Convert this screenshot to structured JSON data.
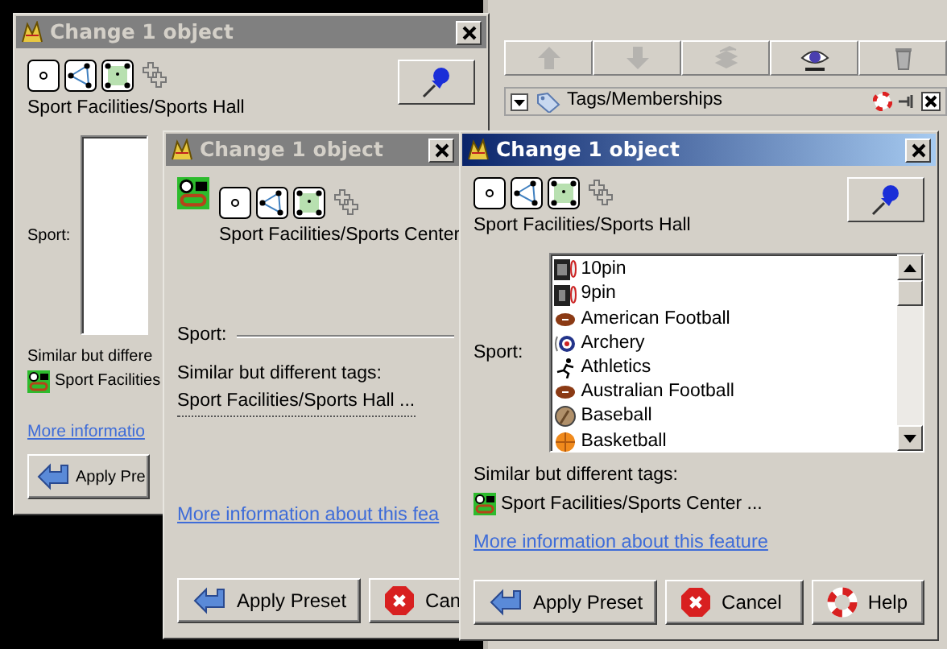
{
  "side_panel": {
    "toolbar": [
      {
        "kind": "up",
        "disabled": true
      },
      {
        "kind": "down",
        "disabled": true
      },
      {
        "kind": "layers",
        "disabled": true
      },
      {
        "kind": "eye",
        "disabled": false
      },
      {
        "kind": "trash",
        "disabled": false
      }
    ],
    "section": {
      "title": "Tags/Memberships",
      "expanded": true
    }
  },
  "windows": [
    {
      "title": "Change 1 object",
      "active": false,
      "preset_icon": false,
      "pin_button": true,
      "path": "Sport Facilities/Sports Hall",
      "sport": {
        "label": "Sport:",
        "kind": "listbox"
      },
      "similar": {
        "label": "Similar but differe",
        "items": [
          {
            "text": "Sport Facilities",
            "icon": true
          }
        ]
      },
      "link": "More informatio",
      "buttons": [
        {
          "label": "Apply Pre",
          "kind": "apply"
        }
      ]
    },
    {
      "title": "Change 1 object",
      "active": false,
      "preset_icon": true,
      "pin_button": false,
      "path": "Sport Facilities/Sports Center",
      "sport": {
        "label": "Sport:",
        "kind": "line"
      },
      "similar": {
        "label": "Similar but different tags:",
        "items": [
          {
            "text": "Sport Facilities/Sports Hall ...",
            "icon": false
          }
        ]
      },
      "link": "More information about this fea",
      "buttons": [
        {
          "label": "Apply Preset",
          "kind": "apply"
        },
        {
          "label": "Can",
          "kind": "cancel"
        }
      ]
    },
    {
      "title": "Change 1 object",
      "active": true,
      "preset_icon": false,
      "pin_button": true,
      "path": "Sport Facilities/Sports Hall",
      "sport": {
        "label": "Sport:",
        "kind": "listbox",
        "items": [
          "10pin",
          "9pin",
          "American Football",
          "Archery",
          "Athletics",
          "Australian Football",
          "Baseball",
          "Basketball"
        ]
      },
      "similar": {
        "label": "Similar but different tags:",
        "items": [
          {
            "text": "Sport Facilities/Sports Center ...",
            "icon": true
          }
        ]
      },
      "link": "More information about this feature",
      "buttons": [
        {
          "label": "Apply Preset",
          "kind": "apply"
        },
        {
          "label": "Cancel",
          "kind": "cancel"
        },
        {
          "label": "Help",
          "kind": "help"
        }
      ]
    }
  ]
}
